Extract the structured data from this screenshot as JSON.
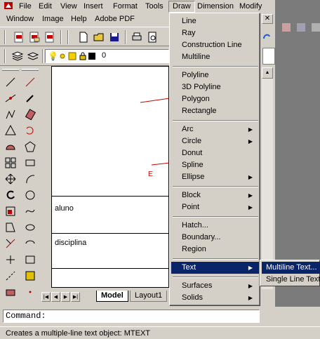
{
  "menubar": {
    "items": [
      {
        "label": "File"
      },
      {
        "label": "Edit"
      },
      {
        "label": "View"
      },
      {
        "label": "Insert"
      },
      {
        "label": "Format"
      },
      {
        "label": "Tools"
      },
      {
        "label": "Draw"
      },
      {
        "label": "Dimension"
      },
      {
        "label": "Modify"
      }
    ],
    "items2": [
      {
        "label": "Window"
      },
      {
        "label": "Image"
      },
      {
        "label": "Help"
      },
      {
        "label": "Adobe PDF"
      }
    ],
    "close_glyph": "✕"
  },
  "layers": {
    "current_layer": "0"
  },
  "drawing": {
    "row1_text": "aluno",
    "row2_text": "disciplina",
    "red_letter": "E"
  },
  "tabs": {
    "model": "Model",
    "layout1": "Layout1"
  },
  "draw_menu": {
    "items": [
      {
        "label": "Line",
        "submenu": false
      },
      {
        "label": "Ray",
        "submenu": false
      },
      {
        "label": "Construction Line",
        "submenu": false
      },
      {
        "label": "Multiline",
        "submenu": false
      },
      {
        "label": "Polyline",
        "submenu": false
      },
      {
        "label": "3D Polyline",
        "submenu": false
      },
      {
        "label": "Polygon",
        "submenu": false
      },
      {
        "label": "Rectangle",
        "submenu": false
      },
      {
        "label": "Arc",
        "submenu": true
      },
      {
        "label": "Circle",
        "submenu": true
      },
      {
        "label": "Donut",
        "submenu": false
      },
      {
        "label": "Spline",
        "submenu": false
      },
      {
        "label": "Ellipse",
        "submenu": true
      },
      {
        "label": "Block",
        "submenu": true
      },
      {
        "label": "Point",
        "submenu": true
      },
      {
        "label": "Hatch...",
        "submenu": false
      },
      {
        "label": "Boundary...",
        "submenu": false
      },
      {
        "label": "Region",
        "submenu": false
      },
      {
        "label": "Text",
        "submenu": true,
        "highlighted": true
      },
      {
        "label": "Surfaces",
        "submenu": true
      },
      {
        "label": "Solids",
        "submenu": true
      }
    ]
  },
  "text_submenu": {
    "items": [
      {
        "label": "Multiline Text...",
        "highlighted": true
      },
      {
        "label": "Single Line Text",
        "highlighted": false
      }
    ]
  },
  "command": {
    "prompt": "Command:"
  },
  "status": {
    "text": "Creates a multiple-line text object:  MTEXT"
  },
  "colors": {
    "menu_highlight": "#0a246a",
    "window_bg": "#d4d0c8",
    "red_geometry": "#cc0000"
  }
}
